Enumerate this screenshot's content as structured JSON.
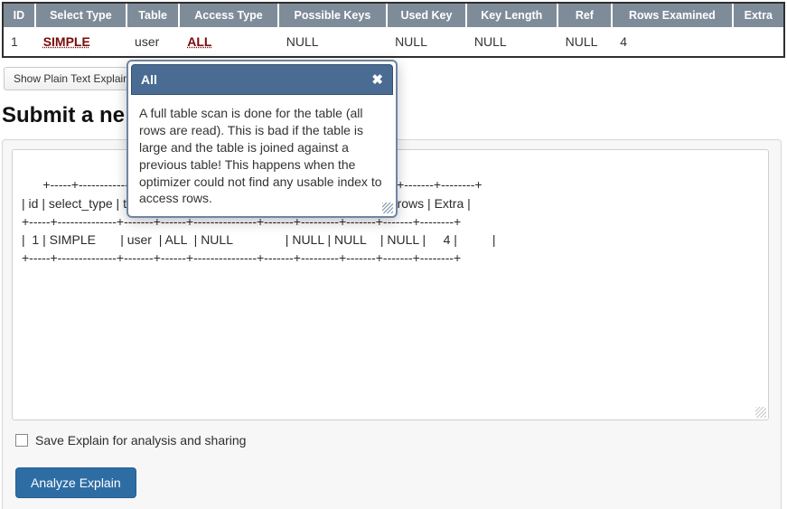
{
  "table": {
    "headers": [
      "ID",
      "Select Type",
      "Table",
      "Access Type",
      "Possible Keys",
      "Used Key",
      "Key Length",
      "Ref",
      "Rows Examined",
      "Extra"
    ],
    "row": {
      "id": "1",
      "select_type": "SIMPLE",
      "table": "user",
      "access_type": "ALL",
      "possible_keys": "NULL",
      "used_key": "NULL",
      "key_length": "NULL",
      "ref": "NULL",
      "rows_examined": "4",
      "extra": ""
    }
  },
  "plain_button": "Show Plain Text Explain",
  "heading": "Submit a ne",
  "textarea": "+-----+--------------+-------+------+---------------+-------+---------+-------+-------+--------+\n| id | select_type | table | type | possible_keys | key | key_len | ref  | rows | Extra |\n+-----+--------------+-------+------+---------------+-------+---------+-------+-------+--------+\n|  1 | SIMPLE       | user  | ALL  | NULL               | NULL | NULL    | NULL |     4 |          |\n+-----+--------------+-------+------+---------------+-------+---------+-------+-------+--------+",
  "checkbox_label": "Save Explain for analysis and sharing",
  "analyze_button": "Analyze Explain",
  "tooltip": {
    "title": "All",
    "close_glyph": "✖",
    "body": "A full table scan is done for the table (all rows are read). This is bad if the table is large and the table is joined against a previous table! This happens when the optimizer could not find any usable index to access rows."
  }
}
